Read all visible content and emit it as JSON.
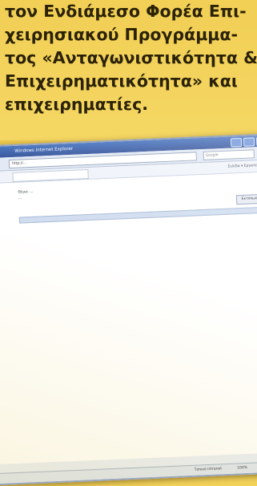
{
  "intro": {
    "lines": [
      "τον Ενδιάμεσο Φορέα Επι-",
      "χειρησιακού Προγράμμα-",
      "τος «Ανταγωνιστικότητα &",
      "Επιχειρηματικότητα» και",
      "επιχειρηματίες."
    ]
  },
  "browser": {
    "title": "Windows Internet Explorer",
    "address": "http://...",
    "search_placeholder": "Google",
    "tab_label": "",
    "tools_label": "Σελίδα ▾  Εργαλεία ▾",
    "doc_id": "",
    "subject_lines": [
      "Θέμα: ...",
      "..."
    ],
    "print_label": "Εκτύπωση",
    "highlight_text": "",
    "paragraphs": [],
    "status_zone": "Τοπικό intranet",
    "status_zoom": "100%"
  },
  "colors": {
    "page_background": "#f3d25a",
    "intro_text": "#2b2206",
    "titlebar": "#1d3f8f"
  }
}
